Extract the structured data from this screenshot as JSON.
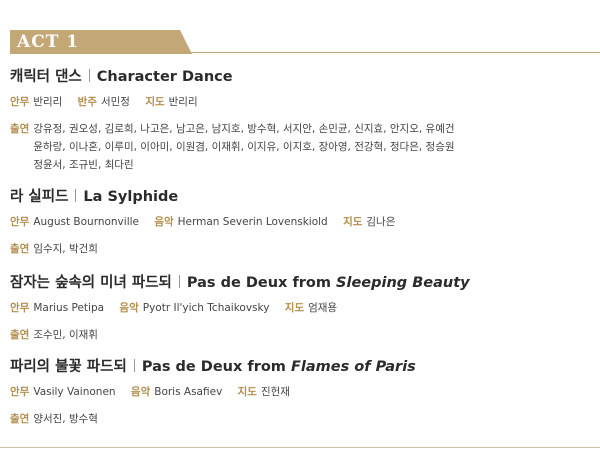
{
  "act": {
    "label": "ACT 1"
  },
  "labels": {
    "choreo": "안무",
    "music": "음악",
    "accomp": "반주",
    "direct": "지도",
    "cast": "출연"
  },
  "pieces": [
    {
      "title_ko": "캐릭터 댄스",
      "title_en": "Character Dance",
      "choreo": "반리리",
      "accomp": "서민정",
      "direct": "반리리",
      "cast_lines": [
        "강유정, 권오성, 김로희, 나고은, 남고은, 남지호, 방수혁, 서지안, 손민균, 신지효, 안지오, 유예건",
        "윤하랑, 이나혼, 이루미, 이아미, 이원겸, 이재휘, 이지유, 이지호, 장아영, 전강혁, 정다은, 정승원",
        "정윤서, 조규빈, 최다린"
      ]
    },
    {
      "title_ko": "라 실피드",
      "title_en": "La Sylphide",
      "choreo": "August Bournonville",
      "music": "Herman Severin Lovenskiold",
      "direct": "김나은",
      "cast_lines": [
        "임수지, 박건희"
      ]
    },
    {
      "title_ko": "잠자는 숲속의 미녀 파드되",
      "title_en_prefix": "Pas de Deux from ",
      "title_en_italic": "Sleeping Beauty",
      "choreo": "Marius Petipa",
      "music": "Pyotr Il'yich Tchaikovsky",
      "direct": "엄재용",
      "cast_lines": [
        "조수민, 이재휘"
      ]
    },
    {
      "title_ko": "파리의 불꽃 파드되",
      "title_en_prefix": "Pas de Deux from ",
      "title_en_italic": "Flames of Paris",
      "choreo": "Vasily Vainonen",
      "music": "Boris Asafiev",
      "direct": "진헌재",
      "cast_lines": [
        "양서진, 방수혁"
      ]
    }
  ]
}
